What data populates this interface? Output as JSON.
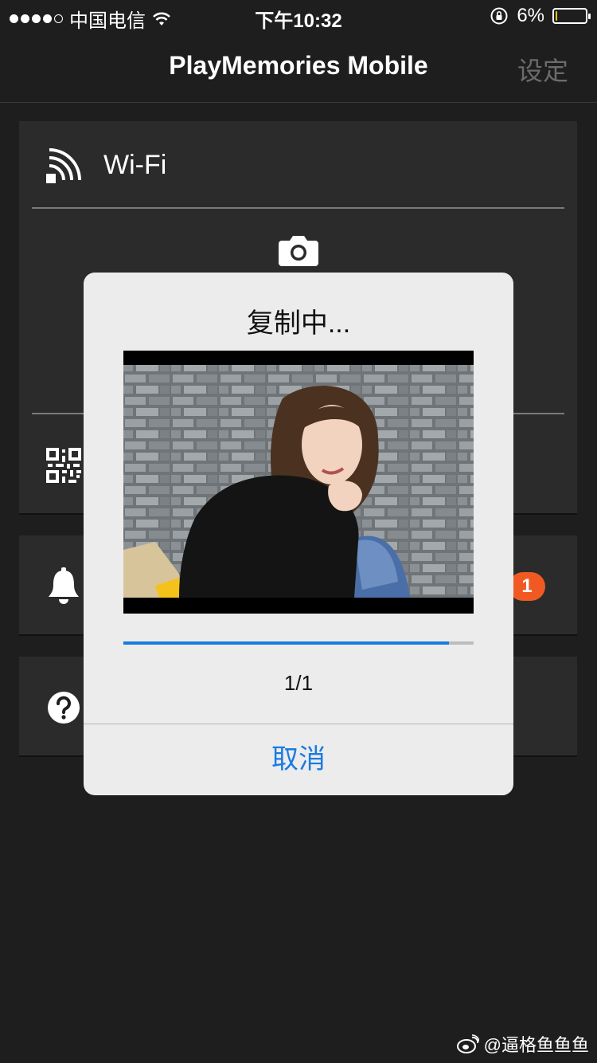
{
  "status_bar": {
    "carrier": "中国电信",
    "time": "下午10:32",
    "battery": "6%",
    "battery_level": 0.06,
    "signal_bars_filled": 4,
    "signal_bars_total": 5
  },
  "nav": {
    "title": "PlayMemories Mobile",
    "settings": "设定"
  },
  "connection": {
    "wifi_label": "Wi-Fi"
  },
  "notifications": {
    "badge_count": "1"
  },
  "dialog": {
    "title": "复制中...",
    "progress": 0.93,
    "counter": "1/1",
    "cancel": "取消"
  },
  "watermark": {
    "text": "@逼格鱼鱼鱼"
  },
  "colors": {
    "accent": "#1a7be0",
    "badge": "#f05a22",
    "background": "#1e1e1e",
    "card": "#2b2b2b",
    "dialog": "#ececec"
  }
}
